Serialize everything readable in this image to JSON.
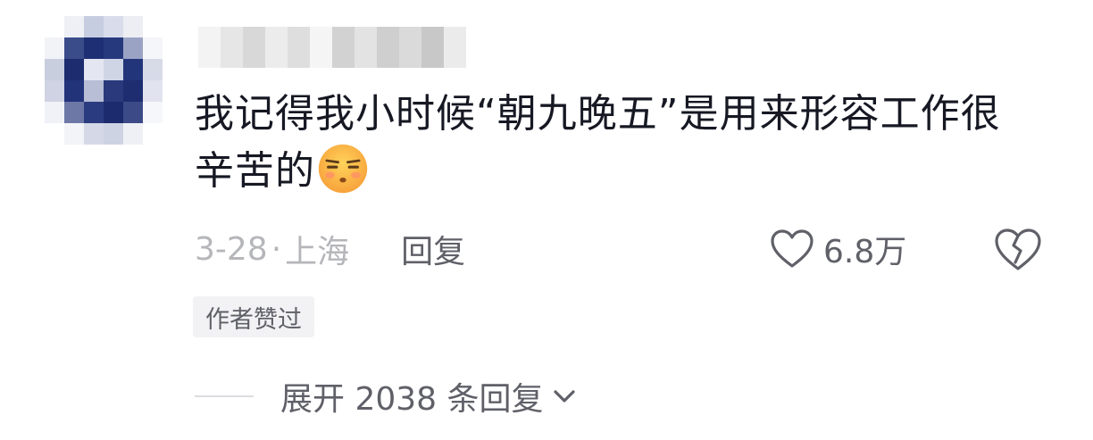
{
  "comment": {
    "avatar_icon": "user-avatar-pixelated",
    "username_icon": "username-pixelated",
    "text": "我记得我小时候“朝九晚五”是用来形容工作很辛苦的",
    "emoji_icon": "sleepy-face-emoji",
    "time": "3-28",
    "separator": "·",
    "location": "上海",
    "reply_label": "回复",
    "like_icon": "heart-icon",
    "like_count": "6.8万",
    "dislike_icon": "broken-heart-icon",
    "author_badge": "作者赞过",
    "expand_replies_label": "展开 2038 条回复",
    "expand_icon": "chevron-down-icon"
  },
  "colors": {
    "text_primary": "#161823",
    "text_secondary": "#5f6068",
    "text_muted": "#b5b6ba",
    "badge_bg": "#f2f2f4",
    "emoji_face": "#fbb042"
  }
}
